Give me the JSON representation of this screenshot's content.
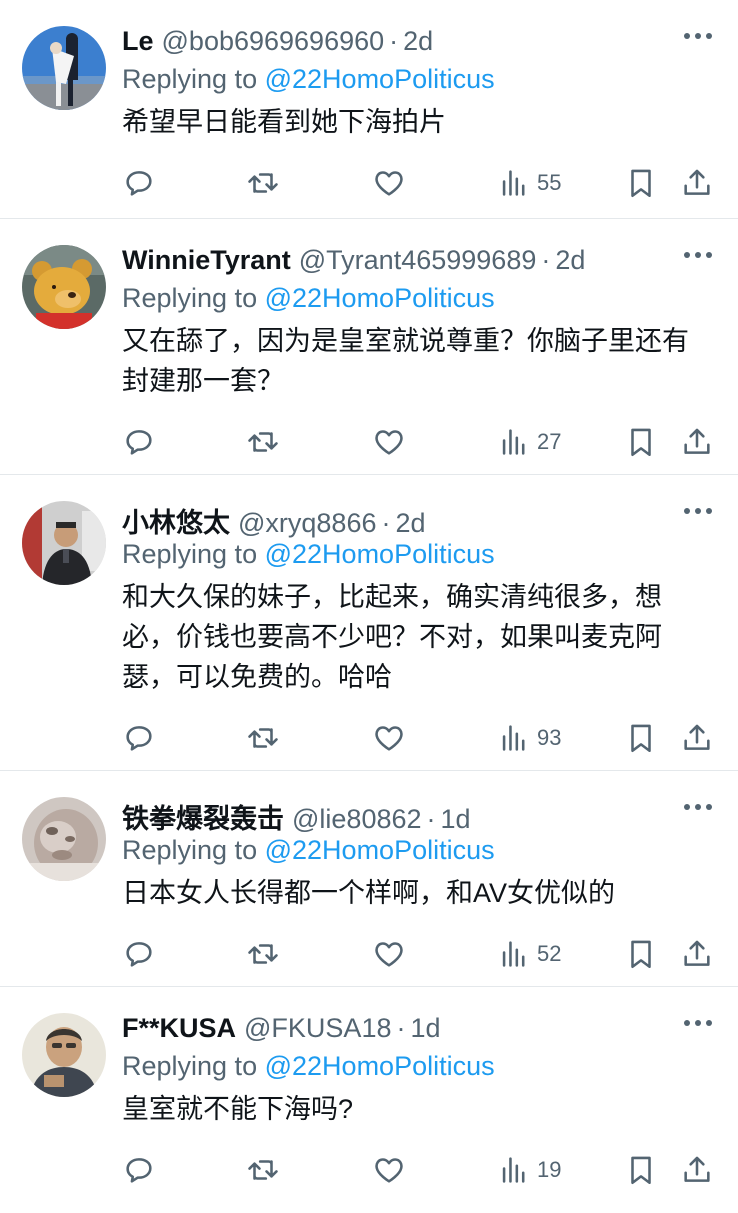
{
  "reply_prefix": "Replying to",
  "separator": "·",
  "tweets": [
    {
      "name": "Le",
      "handle": "@bob6969696960",
      "time": "2d",
      "replying_to": "@22HomoPoliticus",
      "text": "希望早日能看到她下海拍片",
      "views": "55",
      "avatar_icon": "avatar-photo-sailor-kiss"
    },
    {
      "name": "WinnieTyrant",
      "handle": "@Tyrant465999689",
      "time": "2d",
      "replying_to": "@22HomoPoliticus",
      "text": "又在舔了，因为是皇室就说尊重？你脑子里还有封建那一套？",
      "views": "27",
      "avatar_icon": "avatar-winnie-the-pooh"
    },
    {
      "name": "小林悠太",
      "handle": "@xryq8866",
      "time": "2d",
      "replying_to": "@22HomoPoliticus",
      "text": "和大久保的妹子，比起来，确实清纯很多，想必，价钱也要高不少吧？不对，如果叫麦克阿瑟，可以免费的。哈哈",
      "views": "93",
      "avatar_icon": "avatar-man-in-jacket"
    },
    {
      "name": "铁拳爆裂轰击",
      "handle": "@lie80862",
      "time": "1d",
      "replying_to": "@22HomoPoliticus",
      "text": "日本女人长得都一个样啊，和AV女优似的",
      "views": "52",
      "avatar_icon": "avatar-blurry-face"
    },
    {
      "name": "F**KUSA",
      "handle": "@FKUSA18",
      "time": "1d",
      "replying_to": "@22HomoPoliticus",
      "text": "皇室就不能下海吗?",
      "views": "19",
      "avatar_icon": "avatar-man-portrait"
    }
  ],
  "colors": {
    "text": "#0f1419",
    "secondary": "#536471",
    "mention": "#1d9bf0",
    "divider": "#e4e8eb"
  }
}
